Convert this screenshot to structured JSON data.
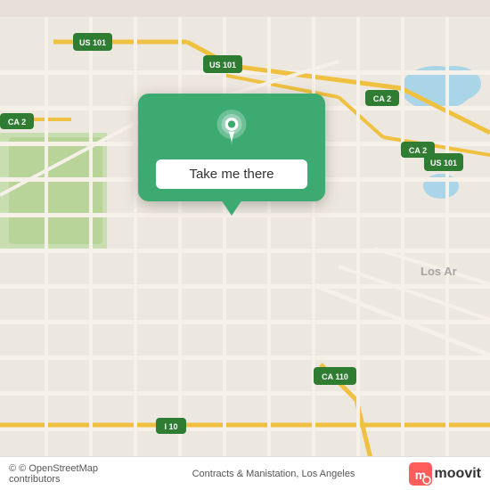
{
  "map": {
    "background_color": "#e8e0d8",
    "attribution": "© OpenStreetMap contributors",
    "location_label": "Contracts & Manistation, Los Angeles"
  },
  "popup": {
    "button_label": "Take me there"
  },
  "moovit": {
    "text": "moovit"
  },
  "route_badges": [
    {
      "label": "US 101",
      "color": "#2e7d32"
    },
    {
      "label": "CA 2",
      "color": "#2e7d32"
    },
    {
      "label": "CA 110",
      "color": "#2e7d32"
    },
    {
      "label": "I 10",
      "color": "#2e7d32"
    }
  ]
}
